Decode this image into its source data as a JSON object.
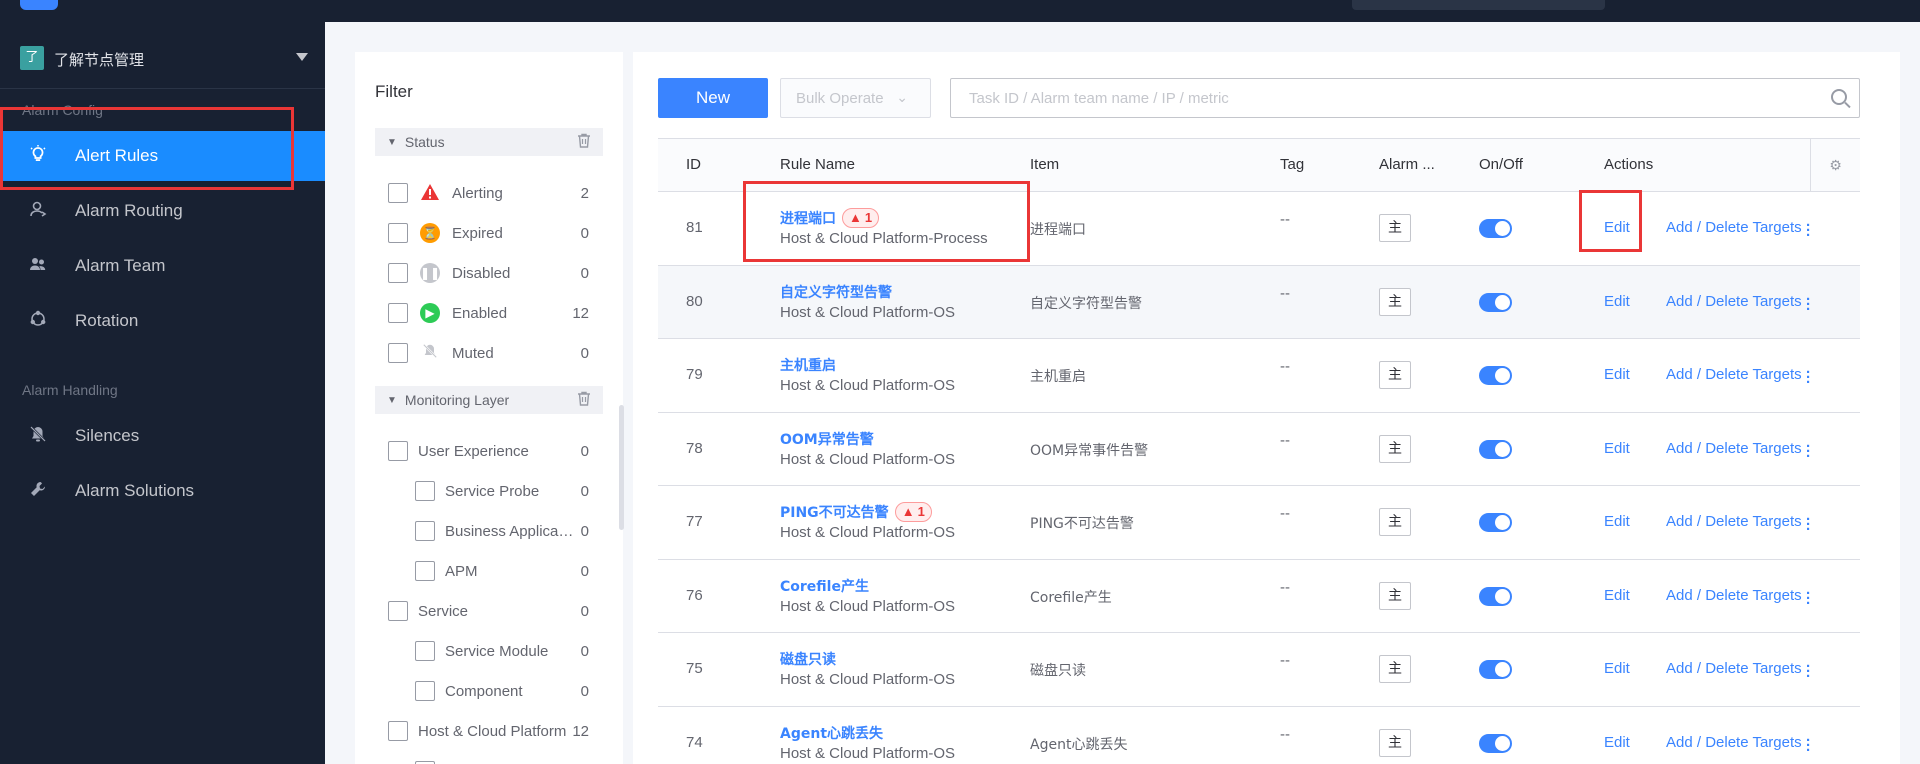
{
  "sidebar": {
    "biz_badge": "了",
    "biz_name": "了解节点管理",
    "group_alarm_config": "Alarm Config",
    "group_alarm_handling": "Alarm Handling",
    "items": [
      {
        "label": "Alert Rules",
        "icon": "lightbulb-icon"
      },
      {
        "label": "Alarm Routing",
        "icon": "user-route-icon"
      },
      {
        "label": "Alarm Team",
        "icon": "team-icon"
      },
      {
        "label": "Rotation",
        "icon": "rotation-icon"
      },
      {
        "label": "Silences",
        "icon": "bell-off-icon"
      },
      {
        "label": "Alarm Solutions",
        "icon": "wrench-icon"
      }
    ]
  },
  "filter": {
    "title": "Filter",
    "status_section": "Status",
    "status_items": [
      {
        "label": "Alerting",
        "count": "2",
        "color": "#ea3636"
      },
      {
        "label": "Expired",
        "count": "0",
        "color": "#ff9c01"
      },
      {
        "label": "Disabled",
        "count": "0",
        "color": "#c4c6cc"
      },
      {
        "label": "Enabled",
        "count": "12",
        "color": "#2dcb56"
      },
      {
        "label": "Muted",
        "count": "0",
        "color": "#c4c6cc"
      }
    ],
    "layer_section": "Monitoring Layer",
    "layer_items": [
      {
        "label": "User Experience",
        "count": "0",
        "indent": false
      },
      {
        "label": "Service Probe",
        "count": "0",
        "indent": true
      },
      {
        "label": "Business Applica…",
        "count": "0",
        "indent": true
      },
      {
        "label": "APM",
        "count": "0",
        "indent": true
      },
      {
        "label": "Service",
        "count": "0",
        "indent": false
      },
      {
        "label": "Service Module",
        "count": "0",
        "indent": true
      },
      {
        "label": "Component",
        "count": "0",
        "indent": true
      },
      {
        "label": "Host & Cloud Platform",
        "count": "12",
        "indent": false
      }
    ]
  },
  "toolbar": {
    "new_label": "New",
    "bulk_label": "Bulk Operate",
    "search_placeholder": "Task ID / Alarm team name / IP / metric"
  },
  "table": {
    "columns": {
      "id": "ID",
      "rule_name": "Rule Name",
      "item": "Item",
      "tag": "Tag",
      "alarm": "Alarm ...",
      "onoff": "On/Off",
      "actions": "Actions"
    },
    "edit_label": "Edit",
    "targets_label": "Add / Delete Targets",
    "rows": [
      {
        "id": "81",
        "name": "进程端口",
        "badge": "1",
        "category": "Host & Cloud Platform-Process",
        "item": "进程端口",
        "tag": "--",
        "alarm": "主",
        "enabled": true
      },
      {
        "id": "80",
        "name": "自定义字符型告警",
        "badge": "",
        "category": "Host & Cloud Platform-OS",
        "item": "自定义字符型告警",
        "tag": "--",
        "alarm": "主",
        "enabled": true
      },
      {
        "id": "79",
        "name": "主机重启",
        "badge": "",
        "category": "Host & Cloud Platform-OS",
        "item": "主机重启",
        "tag": "--",
        "alarm": "主",
        "enabled": true
      },
      {
        "id": "78",
        "name": "OOM异常告警",
        "badge": "",
        "category": "Host & Cloud Platform-OS",
        "item": "OOM异常事件告警",
        "tag": "--",
        "alarm": "主",
        "enabled": true
      },
      {
        "id": "77",
        "name": "PING不可达告警",
        "badge": "1",
        "category": "Host & Cloud Platform-OS",
        "item": "PING不可达告警",
        "tag": "--",
        "alarm": "主",
        "enabled": true
      },
      {
        "id": "76",
        "name": "Corefile产生",
        "badge": "",
        "category": "Host & Cloud Platform-OS",
        "item": "Corefile产生",
        "tag": "--",
        "alarm": "主",
        "enabled": true
      },
      {
        "id": "75",
        "name": "磁盘只读",
        "badge": "",
        "category": "Host & Cloud Platform-OS",
        "item": "磁盘只读",
        "tag": "--",
        "alarm": "主",
        "enabled": true
      },
      {
        "id": "74",
        "name": "Agent心跳丢失",
        "badge": "",
        "category": "Host & Cloud Platform-OS",
        "item": "Agent心跳丢失",
        "tag": "--",
        "alarm": "主",
        "enabled": true
      }
    ]
  },
  "colors": {
    "accent": "#3a84ff",
    "sidebar_bg": "#182132",
    "active_nav": "#1a8cff",
    "highlight": "#ea3636"
  }
}
